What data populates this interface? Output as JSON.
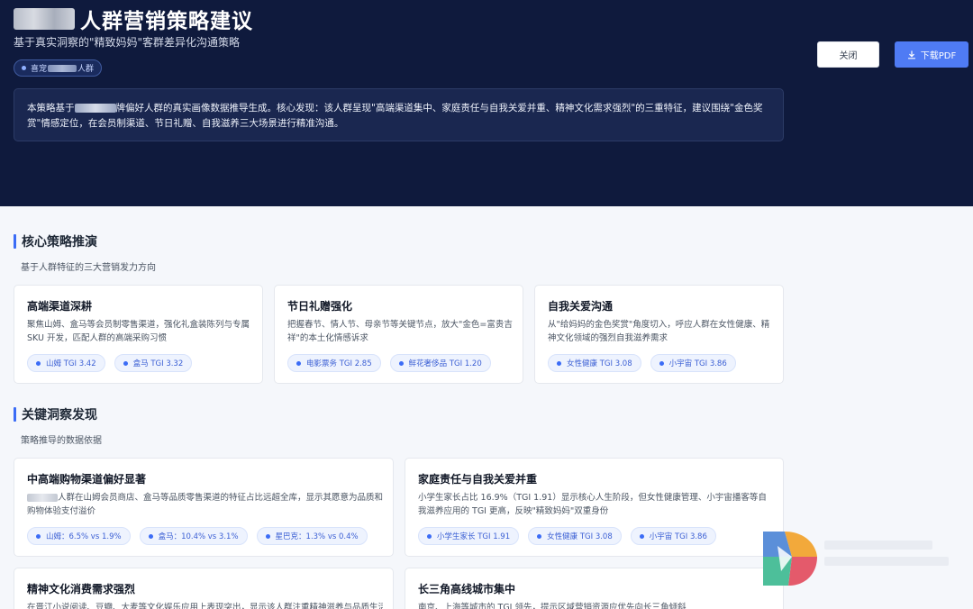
{
  "header": {
    "title": "人群营销策略建议",
    "subtitle": "基于真实洞察的\"精致妈妈\"客群差异化沟通策略",
    "tag": {
      "prefix": "喜宠",
      "suffix": "人群"
    },
    "summary": {
      "part1": "本策略基于",
      "part2": "牌偏好人群的真实画像数据推导生成。核心发现：该人群呈现\"高端渠道集中、家庭责任与自我关爱并重、精神文化需求强烈\"的三重特征，建议围绕\"金色奖赏\"情感定位，在会员制渠道、节日礼赠、自我滋养三大场景进行精准沟通。"
    },
    "buttons": {
      "close": "关闭",
      "download": "下载PDF"
    }
  },
  "strategy": {
    "title": "核心策略推演",
    "subtitle": "基于人群特征的三大营销发力方向",
    "cards": [
      {
        "title": "高端渠道深耕",
        "desc": "聚焦山姆、盒马等会员制零售渠道，强化礼盒装陈列与专属 SKU 开发，匹配人群的高端采购习惯",
        "chips": [
          "山姆 TGI 3.42",
          "盒马 TGI 3.32"
        ]
      },
      {
        "title": "节日礼赠强化",
        "desc": "把握春节、情人节、母亲节等关键节点，放大\"金色=富贵吉祥\"的本土化情感诉求",
        "chips": [
          "电影票务 TGI 2.85",
          "鲜花奢侈品 TGI 1.20"
        ]
      },
      {
        "title": "自我关爱沟通",
        "desc": "从\"给妈妈的金色奖赏\"角度切入，呼应人群在女性健康、精神文化领域的强烈自我滋养需求",
        "chips": [
          "女性健康 TGI 3.08",
          "小宇宙 TGI 3.86"
        ]
      }
    ]
  },
  "insights": {
    "title": "关键洞察发现",
    "subtitle": "策略推导的数据依据",
    "cards": [
      {
        "title": "中高端购物渠道偏好显著",
        "desc": "人群在山姆会员商店、盒马等品质零售渠道的特征占比远超全库，显示其愿意为品质和购物体验支付溢价",
        "chips": [
          "山姆：6.5% vs 1.9%",
          "盒马：10.4% vs 3.1%",
          "星巴克：1.3% vs 0.4%"
        ]
      },
      {
        "title": "家庭责任与自我关爱并重",
        "desc": "小学生家长占比 16.9%（TGI 1.91）显示核心人生阶段，但女性健康管理、小宇宙播客等自我滋养应用的 TGI 更高，反映\"精致妈妈\"双重身份",
        "chips": [
          "小学生家长 TGI 1.91",
          "女性健康 TGI 3.08",
          "小宇宙 TGI 3.86"
        ]
      },
      {
        "title": "精神文化消费需求强烈",
        "desc": "在晋江小说阅读、豆瓣、大麦等文化娱乐应用上表现突出，显示该人群注重精神滋养与品质生活"
      },
      {
        "title": "长三角高线城市集中",
        "desc": "南京、上海等城市的 TGI 领先，提示区域营销资源应优先向长三角倾斜"
      }
    ]
  }
}
